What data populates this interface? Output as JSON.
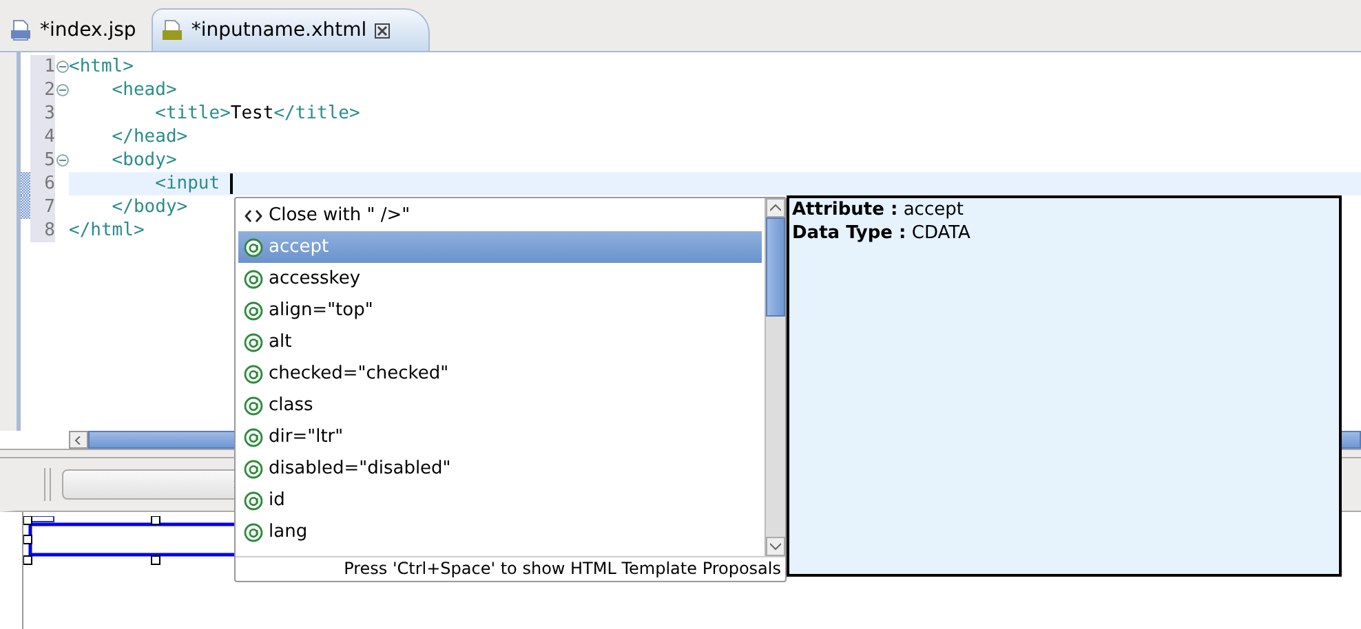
{
  "tabs": [
    {
      "label": "*index.jsp",
      "kind": "jsp",
      "selected": false,
      "closable": false
    },
    {
      "label": "*inputname.xhtml",
      "kind": "htm",
      "selected": true,
      "closable": true
    }
  ],
  "editor": {
    "lines": [
      {
        "number": "1",
        "foldable": true,
        "current": false,
        "changed": false,
        "tokens": [
          {
            "kind": "tag",
            "text": "<html>"
          }
        ]
      },
      {
        "number": "2",
        "foldable": true,
        "current": false,
        "changed": false,
        "tokens": [
          {
            "kind": "tag",
            "text": "    <head>"
          }
        ]
      },
      {
        "number": "3",
        "foldable": false,
        "current": false,
        "changed": false,
        "tokens": [
          {
            "kind": "tag",
            "text": "        <title>"
          },
          {
            "kind": "text",
            "text": "Test"
          },
          {
            "kind": "tag",
            "text": "</title>"
          }
        ]
      },
      {
        "number": "4",
        "foldable": false,
        "current": false,
        "changed": false,
        "tokens": [
          {
            "kind": "tag",
            "text": "    </head>"
          }
        ]
      },
      {
        "number": "5",
        "foldable": true,
        "current": false,
        "changed": false,
        "tokens": [
          {
            "kind": "tag",
            "text": "    <body>"
          }
        ]
      },
      {
        "number": "6",
        "foldable": false,
        "current": true,
        "changed": true,
        "tokens": [
          {
            "kind": "tag",
            "text": "        <input"
          }
        ]
      },
      {
        "number": "7",
        "foldable": false,
        "current": false,
        "changed": true,
        "tokens": [
          {
            "kind": "tag",
            "text": "    </body>"
          }
        ]
      },
      {
        "number": "8",
        "foldable": false,
        "current": false,
        "changed": false,
        "tokens": [
          {
            "kind": "tag",
            "text": "</html>"
          }
        ]
      }
    ]
  },
  "completion": {
    "items": [
      {
        "kind": "close",
        "label": "Close with \" />\"",
        "selected": false
      },
      {
        "kind": "attribute",
        "label": "accept",
        "selected": true
      },
      {
        "kind": "attribute",
        "label": "accesskey",
        "selected": false
      },
      {
        "kind": "attribute",
        "label": "align=\"top\"",
        "selected": false
      },
      {
        "kind": "attribute",
        "label": "alt",
        "selected": false
      },
      {
        "kind": "attribute",
        "label": "checked=\"checked\"",
        "selected": false
      },
      {
        "kind": "attribute",
        "label": "class",
        "selected": false
      },
      {
        "kind": "attribute",
        "label": "dir=\"ltr\"",
        "selected": false
      },
      {
        "kind": "attribute",
        "label": "disabled=\"disabled\"",
        "selected": false
      },
      {
        "kind": "attribute",
        "label": "id",
        "selected": false
      },
      {
        "kind": "attribute",
        "label": "lang",
        "selected": false
      }
    ],
    "footer": "Press 'Ctrl+Space' to show HTML Template Proposals"
  },
  "info": {
    "lines": [
      {
        "label": "Attribute :",
        "value": "accept"
      },
      {
        "label": "Data Type :",
        "value": "CDATA"
      }
    ]
  }
}
